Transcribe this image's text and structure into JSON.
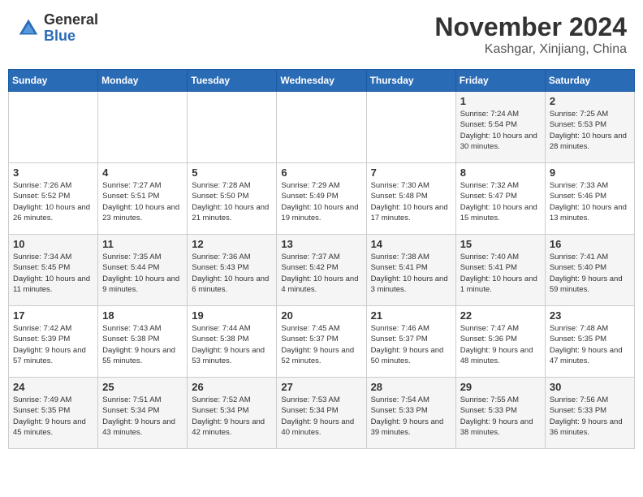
{
  "header": {
    "logo_general": "General",
    "logo_blue": "Blue",
    "month_title": "November 2024",
    "location": "Kashgar, Xinjiang, China"
  },
  "days_of_week": [
    "Sunday",
    "Monday",
    "Tuesday",
    "Wednesday",
    "Thursday",
    "Friday",
    "Saturday"
  ],
  "weeks": [
    [
      {
        "day": "",
        "info": ""
      },
      {
        "day": "",
        "info": ""
      },
      {
        "day": "",
        "info": ""
      },
      {
        "day": "",
        "info": ""
      },
      {
        "day": "",
        "info": ""
      },
      {
        "day": "1",
        "info": "Sunrise: 7:24 AM\nSunset: 5:54 PM\nDaylight: 10 hours and 30 minutes."
      },
      {
        "day": "2",
        "info": "Sunrise: 7:25 AM\nSunset: 5:53 PM\nDaylight: 10 hours and 28 minutes."
      }
    ],
    [
      {
        "day": "3",
        "info": "Sunrise: 7:26 AM\nSunset: 5:52 PM\nDaylight: 10 hours and 26 minutes."
      },
      {
        "day": "4",
        "info": "Sunrise: 7:27 AM\nSunset: 5:51 PM\nDaylight: 10 hours and 23 minutes."
      },
      {
        "day": "5",
        "info": "Sunrise: 7:28 AM\nSunset: 5:50 PM\nDaylight: 10 hours and 21 minutes."
      },
      {
        "day": "6",
        "info": "Sunrise: 7:29 AM\nSunset: 5:49 PM\nDaylight: 10 hours and 19 minutes."
      },
      {
        "day": "7",
        "info": "Sunrise: 7:30 AM\nSunset: 5:48 PM\nDaylight: 10 hours and 17 minutes."
      },
      {
        "day": "8",
        "info": "Sunrise: 7:32 AM\nSunset: 5:47 PM\nDaylight: 10 hours and 15 minutes."
      },
      {
        "day": "9",
        "info": "Sunrise: 7:33 AM\nSunset: 5:46 PM\nDaylight: 10 hours and 13 minutes."
      }
    ],
    [
      {
        "day": "10",
        "info": "Sunrise: 7:34 AM\nSunset: 5:45 PM\nDaylight: 10 hours and 11 minutes."
      },
      {
        "day": "11",
        "info": "Sunrise: 7:35 AM\nSunset: 5:44 PM\nDaylight: 10 hours and 9 minutes."
      },
      {
        "day": "12",
        "info": "Sunrise: 7:36 AM\nSunset: 5:43 PM\nDaylight: 10 hours and 6 minutes."
      },
      {
        "day": "13",
        "info": "Sunrise: 7:37 AM\nSunset: 5:42 PM\nDaylight: 10 hours and 4 minutes."
      },
      {
        "day": "14",
        "info": "Sunrise: 7:38 AM\nSunset: 5:41 PM\nDaylight: 10 hours and 3 minutes."
      },
      {
        "day": "15",
        "info": "Sunrise: 7:40 AM\nSunset: 5:41 PM\nDaylight: 10 hours and 1 minute."
      },
      {
        "day": "16",
        "info": "Sunrise: 7:41 AM\nSunset: 5:40 PM\nDaylight: 9 hours and 59 minutes."
      }
    ],
    [
      {
        "day": "17",
        "info": "Sunrise: 7:42 AM\nSunset: 5:39 PM\nDaylight: 9 hours and 57 minutes."
      },
      {
        "day": "18",
        "info": "Sunrise: 7:43 AM\nSunset: 5:38 PM\nDaylight: 9 hours and 55 minutes."
      },
      {
        "day": "19",
        "info": "Sunrise: 7:44 AM\nSunset: 5:38 PM\nDaylight: 9 hours and 53 minutes."
      },
      {
        "day": "20",
        "info": "Sunrise: 7:45 AM\nSunset: 5:37 PM\nDaylight: 9 hours and 52 minutes."
      },
      {
        "day": "21",
        "info": "Sunrise: 7:46 AM\nSunset: 5:37 PM\nDaylight: 9 hours and 50 minutes."
      },
      {
        "day": "22",
        "info": "Sunrise: 7:47 AM\nSunset: 5:36 PM\nDaylight: 9 hours and 48 minutes."
      },
      {
        "day": "23",
        "info": "Sunrise: 7:48 AM\nSunset: 5:35 PM\nDaylight: 9 hours and 47 minutes."
      }
    ],
    [
      {
        "day": "24",
        "info": "Sunrise: 7:49 AM\nSunset: 5:35 PM\nDaylight: 9 hours and 45 minutes."
      },
      {
        "day": "25",
        "info": "Sunrise: 7:51 AM\nSunset: 5:34 PM\nDaylight: 9 hours and 43 minutes."
      },
      {
        "day": "26",
        "info": "Sunrise: 7:52 AM\nSunset: 5:34 PM\nDaylight: 9 hours and 42 minutes."
      },
      {
        "day": "27",
        "info": "Sunrise: 7:53 AM\nSunset: 5:34 PM\nDaylight: 9 hours and 40 minutes."
      },
      {
        "day": "28",
        "info": "Sunrise: 7:54 AM\nSunset: 5:33 PM\nDaylight: 9 hours and 39 minutes."
      },
      {
        "day": "29",
        "info": "Sunrise: 7:55 AM\nSunset: 5:33 PM\nDaylight: 9 hours and 38 minutes."
      },
      {
        "day": "30",
        "info": "Sunrise: 7:56 AM\nSunset: 5:33 PM\nDaylight: 9 hours and 36 minutes."
      }
    ]
  ]
}
